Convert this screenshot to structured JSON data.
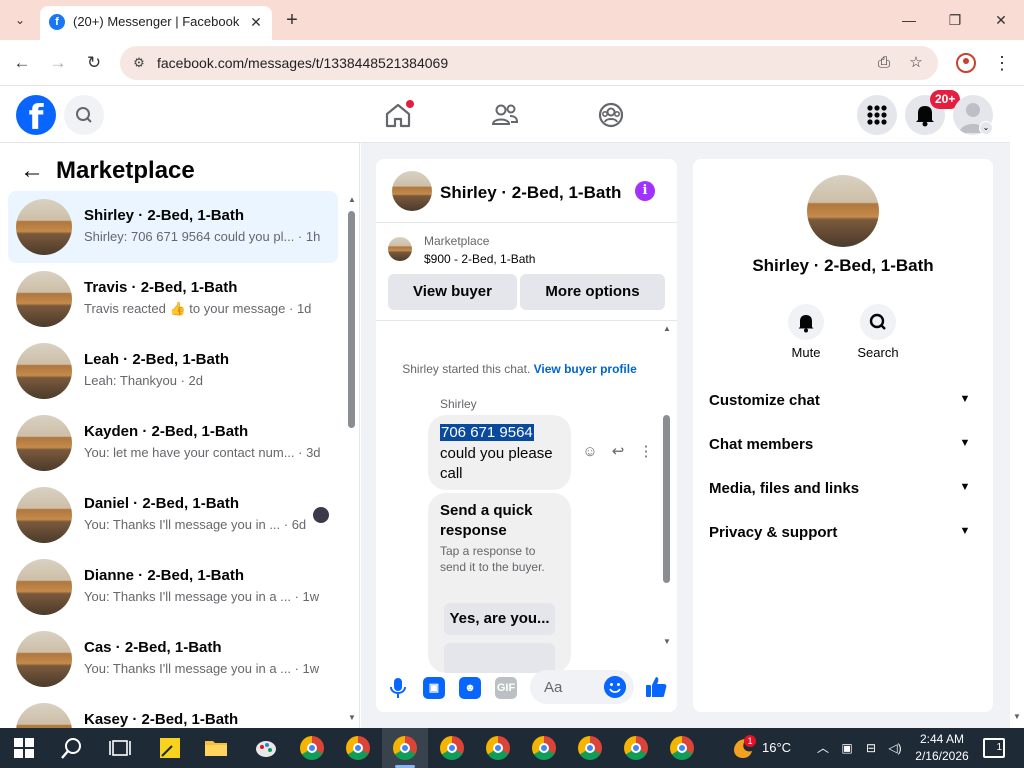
{
  "browser": {
    "tab_title": "(20+) Messenger | Facebook",
    "url": "facebook.com/messages/t/1338448521384069"
  },
  "fb_header": {
    "notification_badge": "20+"
  },
  "left_panel": {
    "title": "Marketplace",
    "conversations": [
      {
        "name": "Shirley · 2-Bed, 1-Bath",
        "snippet": "Shirley: 706 671 9564 could you pl... · 1h",
        "active": true
      },
      {
        "name": "Travis · 2-Bed, 1-Bath",
        "snippet": "Travis reacted 👍 to your message · 1d"
      },
      {
        "name": "Leah · 2-Bed, 1-Bath",
        "snippet": "Leah: Thankyou · 2d"
      },
      {
        "name": "Kayden · 2-Bed, 1-Bath",
        "snippet": "You: let me have your contact num... · 3d"
      },
      {
        "name": "Daniel · 2-Bed, 1-Bath",
        "snippet": "You: Thanks I'll message you in ... · 6d"
      },
      {
        "name": "Dianne · 2-Bed, 1-Bath",
        "snippet": "You: Thanks I'll message you in a ... · 1w"
      },
      {
        "name": "Cas · 2-Bed, 1-Bath",
        "snippet": "You: Thanks I'll message you in a ... · 1w"
      },
      {
        "name": "Kasey · 2-Bed, 1-Bath",
        "snippet": ""
      }
    ]
  },
  "chat": {
    "title": "Shirley · 2-Bed, 1-Bath",
    "listing_label": "Marketplace",
    "listing_price": "$900 - 2-Bed, 1-Bath",
    "view_buyer_label": "View buyer",
    "more_options_label": "More options",
    "started_text": "Shirley started this chat.",
    "view_profile_link": "View buyer profile",
    "sender": "Shirley",
    "message_phone": "706 671 9564",
    "message_text": "could you please call",
    "quick_title": "Send a quick response",
    "quick_sub": "Tap a response to send it to the buyer.",
    "quick_option": "Yes, are you...",
    "input_placeholder": "Aa"
  },
  "info_panel": {
    "name": "Shirley · 2-Bed, 1-Bath",
    "mute_label": "Mute",
    "search_label": "Search",
    "sections": [
      "Customize chat",
      "Chat members",
      "Media, files and links",
      "Privacy & support"
    ]
  },
  "taskbar": {
    "temperature": "16°C",
    "time": "2:44 AM",
    "date": "2/16/2026",
    "weather_badge": "1",
    "notif_count": "1"
  },
  "colors": {
    "facebook_blue": "#0866ff",
    "active_convo_bg": "#ebf5ff",
    "notification_red": "#e41e3f",
    "info_purple": "#a033ff"
  }
}
